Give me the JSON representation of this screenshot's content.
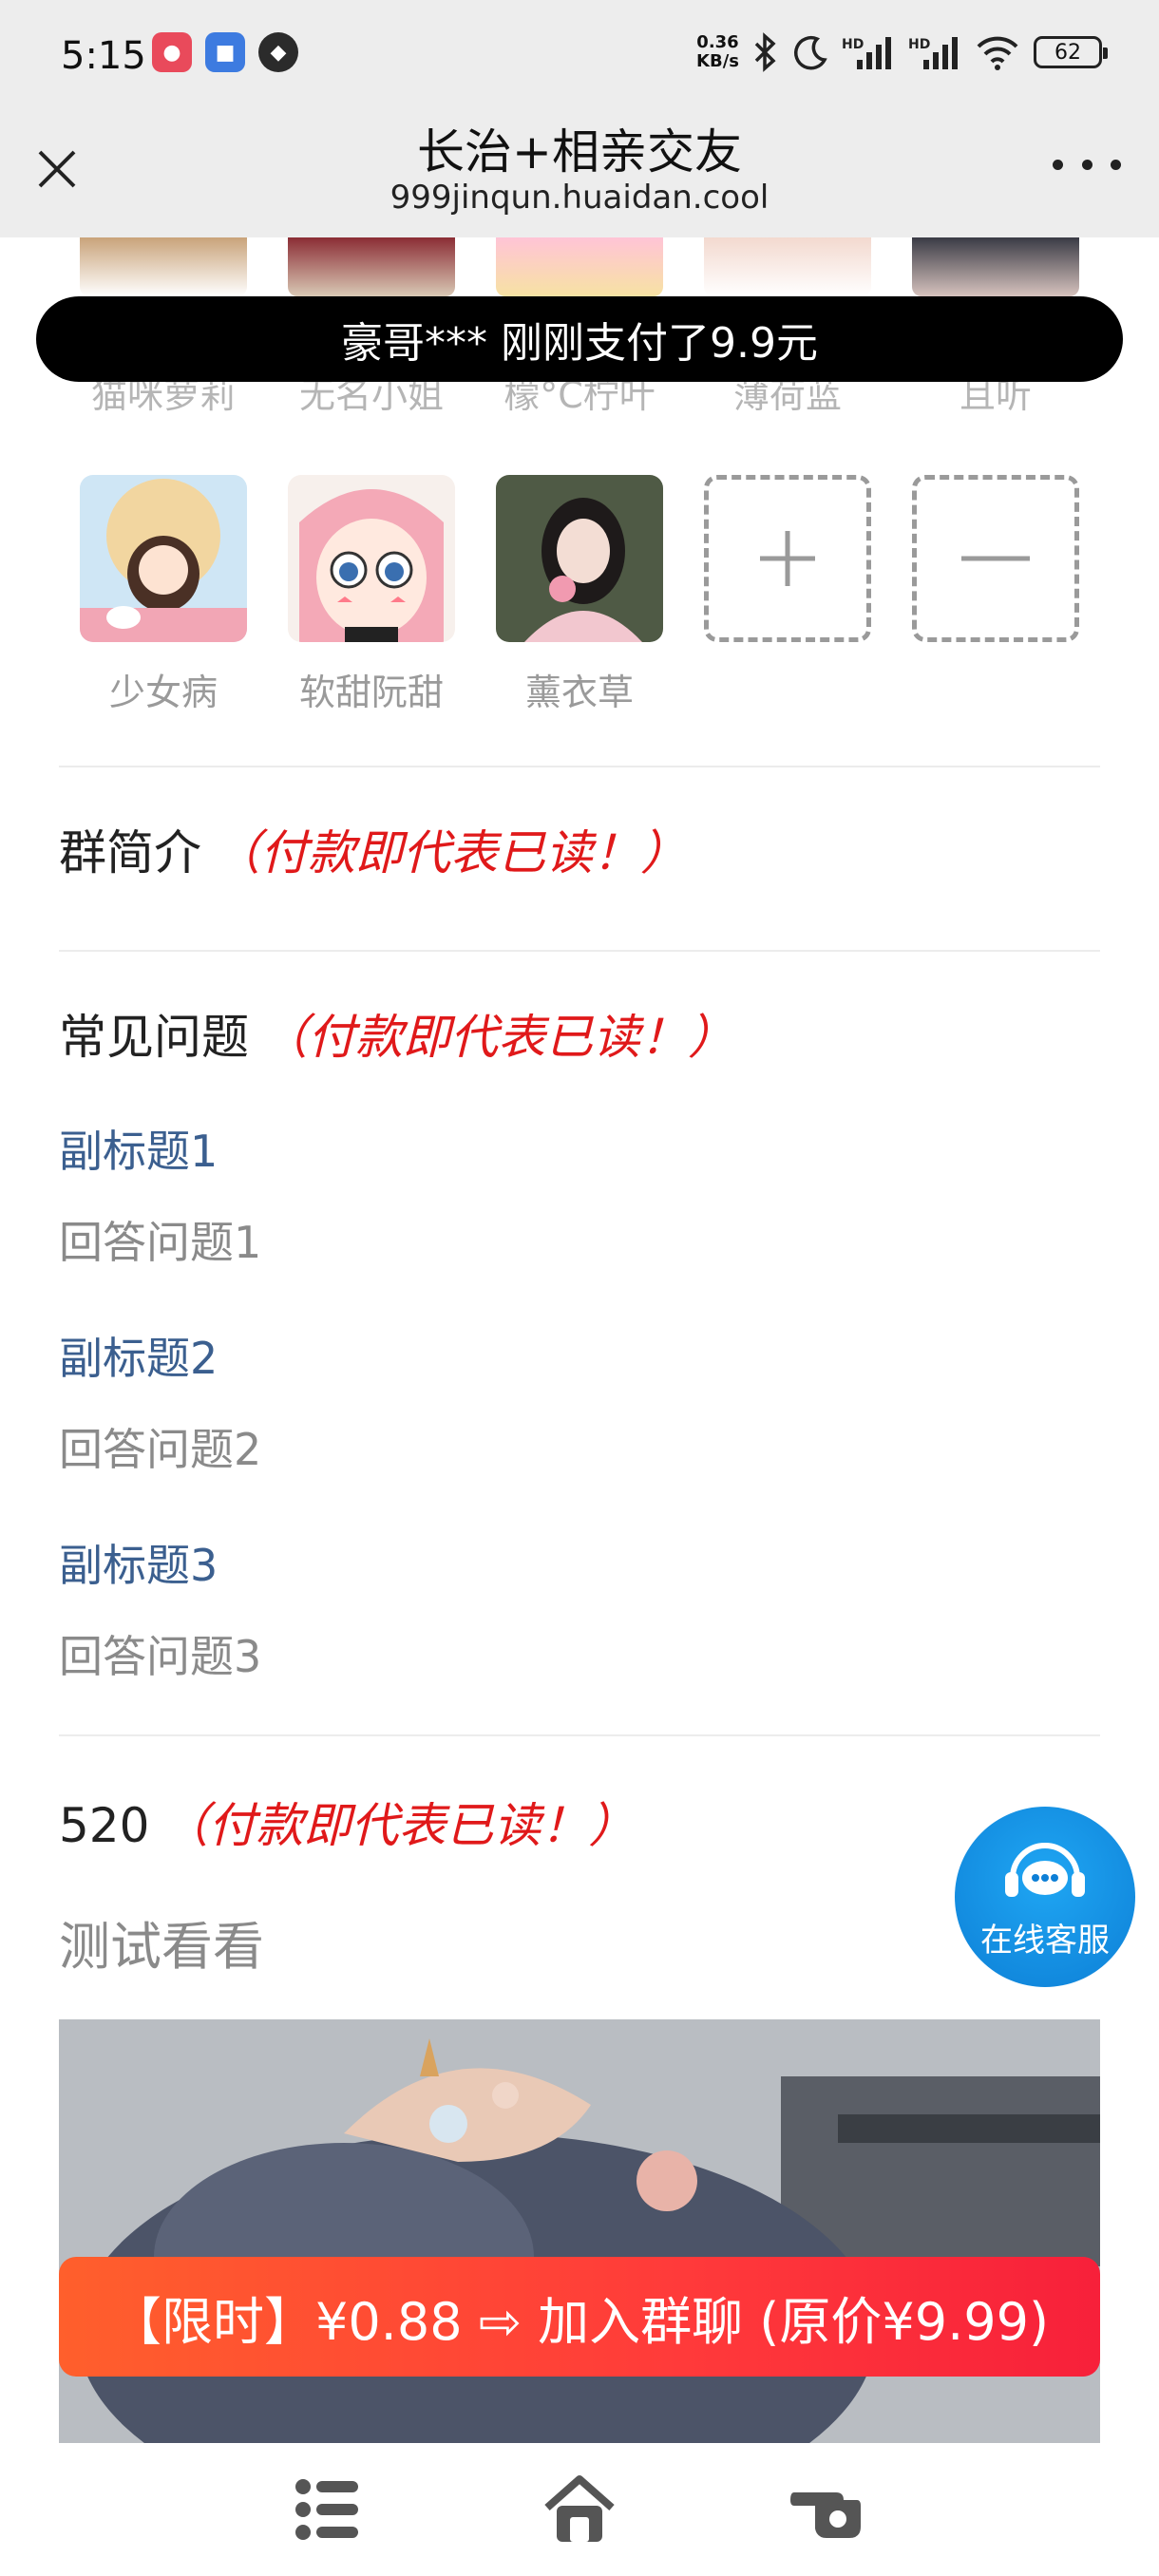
{
  "status_bar": {
    "time": "5:15",
    "net_speed_value": "0.36",
    "net_speed_unit": "KB/s",
    "battery": "62"
  },
  "header": {
    "title": "长治+相亲交友",
    "url": "999jinqun.huaidan.cool"
  },
  "toast": "豪哥*** 刚刚支付了9.9元",
  "members_row1": [
    "猫咪萝莉",
    "无名小姐",
    "檬°C柠叶",
    "薄荷蓝",
    "且听"
  ],
  "members_row2": [
    "少女病",
    "软甜阮甜",
    "薰衣草"
  ],
  "sections": {
    "intro": {
      "title": "群简介",
      "note": "（付款即代表已读！）"
    },
    "faq": {
      "title": "常见问题",
      "note": "（付款即代表已读！）",
      "items": [
        {
          "q": "副标题1",
          "a": "回答问题1"
        },
        {
          "q": "副标题2",
          "a": "回答问题2"
        },
        {
          "q": "副标题3",
          "a": "回答问题3"
        }
      ]
    },
    "extra": {
      "title": "520",
      "note": "（付款即代表已读！）",
      "body": "测试看看"
    }
  },
  "cta": "【限时】¥0.88 ⇨ 加入群聊 (原价¥9.99)",
  "service_button": "在线客服",
  "colors": {
    "note_red": "#e0191a",
    "faq_blue": "#3b5f8f",
    "cta_orange": "#ff5f2c",
    "cta_red": "#f7203a",
    "service_blue": "#0d7fd6"
  },
  "icons": [
    "close-icon",
    "more-icon",
    "plus-icon",
    "minus-icon",
    "headset-chat-icon",
    "list-icon",
    "home-icon",
    "hand-point-icon"
  ]
}
